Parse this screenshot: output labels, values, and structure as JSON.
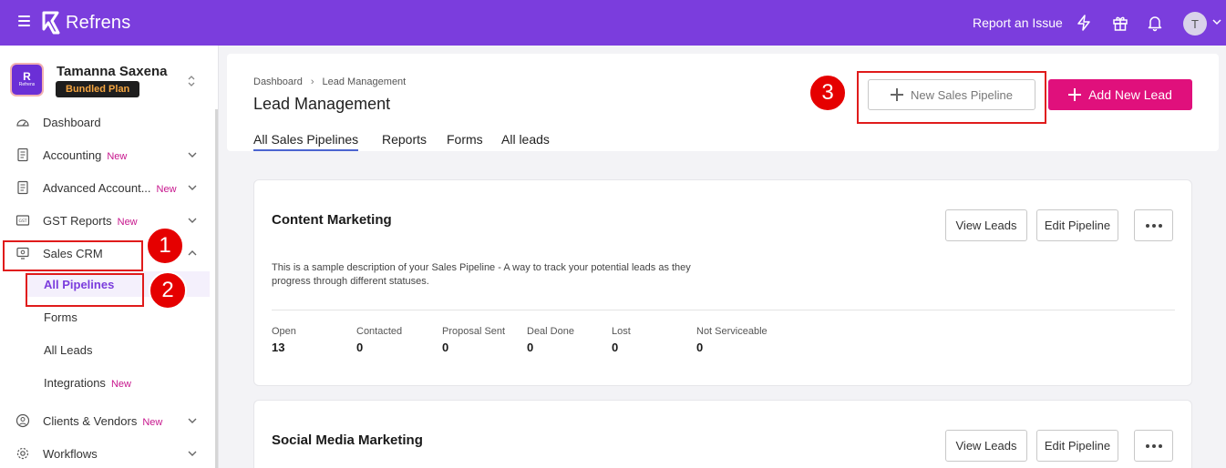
{
  "topbar": {
    "brand": "Refrens",
    "report_issue": "Report an Issue",
    "avatar_initial": "T",
    "icons": [
      "menu-icon",
      "lightning-icon",
      "gift-icon",
      "bell-icon",
      "chevron-down-icon"
    ]
  },
  "org": {
    "logo_text": "Refrens",
    "name": "Tamanna Saxena",
    "plan": "Bundled Plan"
  },
  "sidebar": {
    "items": [
      {
        "label": "Dashboard",
        "icon": "dashboard-icon",
        "new": ""
      },
      {
        "label": "Accounting",
        "icon": "document-icon",
        "new": "New"
      },
      {
        "label": "Advanced Account...",
        "icon": "document-icon",
        "new": "New"
      },
      {
        "label": "GST Reports",
        "icon": "gst-icon",
        "new": "New"
      },
      {
        "label": "Sales CRM",
        "icon": "monitor-icon",
        "new": ""
      },
      {
        "label": "Clients & Vendors",
        "icon": "user-circle-icon",
        "new": "New"
      },
      {
        "label": "Workflows",
        "icon": "gear-icon",
        "new": ""
      }
    ],
    "sub_items": [
      {
        "label": "All Pipelines",
        "new": ""
      },
      {
        "label": "Forms",
        "new": ""
      },
      {
        "label": "All Leads",
        "new": ""
      },
      {
        "label": "Integrations",
        "new": "New"
      }
    ]
  },
  "annotations": [
    "1",
    "2",
    "3"
  ],
  "header": {
    "breadcrumb": [
      "Dashboard",
      "Lead Management"
    ],
    "title": "Lead Management",
    "tabs": [
      "All Sales Pipelines",
      "Reports",
      "Forms",
      "All leads"
    ],
    "active_tab": "All Sales Pipelines",
    "new_pipeline_label": "New Sales Pipeline",
    "add_lead_label": "Add New Lead"
  },
  "pipelines": [
    {
      "name": "Content Marketing",
      "description": "This is a sample description of your Sales Pipeline - A way to track your potential leads as they progress through different statuses.",
      "view_label": "View Leads",
      "edit_label": "Edit Pipeline",
      "stats": [
        {
          "label": "Open",
          "value": "13"
        },
        {
          "label": "Contacted",
          "value": "0"
        },
        {
          "label": "Proposal Sent",
          "value": "0"
        },
        {
          "label": "Deal Done",
          "value": "0"
        },
        {
          "label": "Lost",
          "value": "0"
        },
        {
          "label": "Not Serviceable",
          "value": "0"
        }
      ]
    },
    {
      "name": "Social Media Marketing",
      "view_label": "View Leads",
      "edit_label": "Edit Pipeline"
    }
  ],
  "colors": {
    "topbar": "#7b3ddd",
    "accent_pink": "#e0107c",
    "annotation_red": "#e50000",
    "active_tab_underline": "#4b64d0"
  }
}
